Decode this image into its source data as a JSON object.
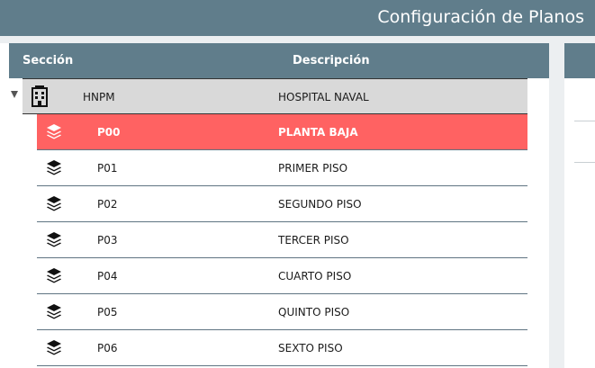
{
  "header": {
    "title": "Configuración de Planos"
  },
  "table": {
    "columns": {
      "seccion": "Sección",
      "descripcion": "Descripción"
    },
    "parent": {
      "code": "HNPM",
      "description": "HOSPITAL NAVAL",
      "icon": "building-icon"
    },
    "children": [
      {
        "code": "P00",
        "description": "PLANTA BAJA",
        "icon": "layers-icon",
        "selected": true
      },
      {
        "code": "P01",
        "description": "PRIMER PISO",
        "icon": "layers-icon"
      },
      {
        "code": "P02",
        "description": "SEGUNDO PISO",
        "icon": "layers-icon"
      },
      {
        "code": "P03",
        "description": "TERCER PISO",
        "icon": "layers-icon"
      },
      {
        "code": "P04",
        "description": "CUARTO PISO",
        "icon": "layers-icon"
      },
      {
        "code": "P05",
        "description": "QUINTO PISO",
        "icon": "layers-icon"
      },
      {
        "code": "P06",
        "description": "SEXTO PISO",
        "icon": "layers-icon"
      }
    ]
  },
  "colors": {
    "header_bg": "#607d8b",
    "selected_row": "#ff6262",
    "parent_row": "#d9d9d9"
  }
}
